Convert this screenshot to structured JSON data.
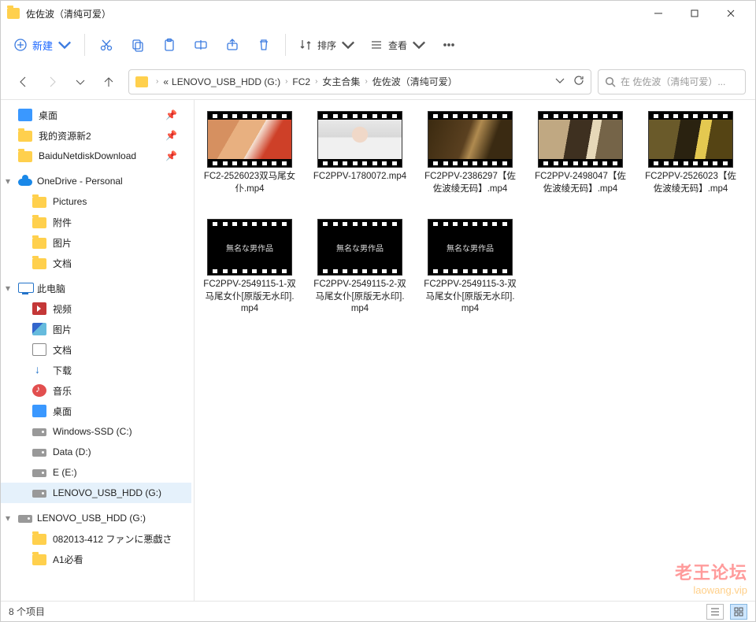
{
  "window": {
    "title": "佐佐波（清纯可爱）"
  },
  "toolbar": {
    "new_label": "新建",
    "sort_label": "排序",
    "view_label": "查看"
  },
  "breadcrumb": {
    "root_glyph": "«",
    "items": [
      "LENOVO_USB_HDD (G:)",
      "FC2",
      "女主合集",
      "佐佐波（清纯可爱）"
    ]
  },
  "search": {
    "placeholder": "在 佐佐波（清纯可爱）..."
  },
  "sidebar": {
    "quick": [
      {
        "label": "桌面",
        "icon": "desk",
        "pin": true
      },
      {
        "label": "我的资源新2",
        "icon": "folder",
        "pin": true
      },
      {
        "label": "BaiduNetdiskDownload",
        "icon": "folder",
        "pin": true
      }
    ],
    "onedrive": {
      "label": "OneDrive - Personal",
      "items": [
        {
          "label": "Pictures",
          "icon": "folder"
        },
        {
          "label": "附件",
          "icon": "folder"
        },
        {
          "label": "图片",
          "icon": "folder"
        },
        {
          "label": "文档",
          "icon": "folder"
        }
      ]
    },
    "thispc": {
      "label": "此电脑",
      "items": [
        {
          "label": "视频",
          "icon": "vid"
        },
        {
          "label": "图片",
          "icon": "pic"
        },
        {
          "label": "文档",
          "icon": "doc"
        },
        {
          "label": "下载",
          "icon": "down"
        },
        {
          "label": "音乐",
          "icon": "music"
        },
        {
          "label": "桌面",
          "icon": "desk"
        },
        {
          "label": "Windows-SSD (C:)",
          "icon": "drive"
        },
        {
          "label": "Data (D:)",
          "icon": "drive"
        },
        {
          "label": "E (E:)",
          "icon": "drive"
        },
        {
          "label": "LENOVO_USB_HDD (G:)",
          "icon": "drive",
          "selected": true
        }
      ]
    },
    "usb": {
      "label": "LENOVO_USB_HDD (G:)",
      "items": [
        {
          "label": "082013-412 ファンに悪戯さ",
          "icon": "folder"
        },
        {
          "label": "A1必看",
          "icon": "folder"
        }
      ]
    }
  },
  "files": [
    {
      "name": "FC2-2526023双马尾女仆.mp4",
      "variant": "v1"
    },
    {
      "name": "FC2PPV-1780072.mp4",
      "variant": "v2"
    },
    {
      "name": "FC2PPV-2386297【佐佐波绫无码】.mp4",
      "variant": "v3"
    },
    {
      "name": "FC2PPV-2498047【佐佐波绫无码】.mp4",
      "variant": "v4"
    },
    {
      "name": "FC2PPV-2526023【佐佐波绫无码】.mp4",
      "variant": "v5"
    },
    {
      "name": "FC2PPV-2549115-1-双马尾女仆[原版无水印].mp4",
      "variant": "dark",
      "overlay": "無名な男作品"
    },
    {
      "name": "FC2PPV-2549115-2-双马尾女仆[原版无水印].mp4",
      "variant": "dark",
      "overlay": "無名な男作品"
    },
    {
      "name": "FC2PPV-2549115-3-双马尾女仆[原版无水印].mp4",
      "variant": "dark",
      "overlay": "無名な男作品"
    }
  ],
  "status": {
    "count_label": "8 个项目"
  },
  "watermark": {
    "line1": "老王论坛",
    "line2": "laowang.vip"
  }
}
